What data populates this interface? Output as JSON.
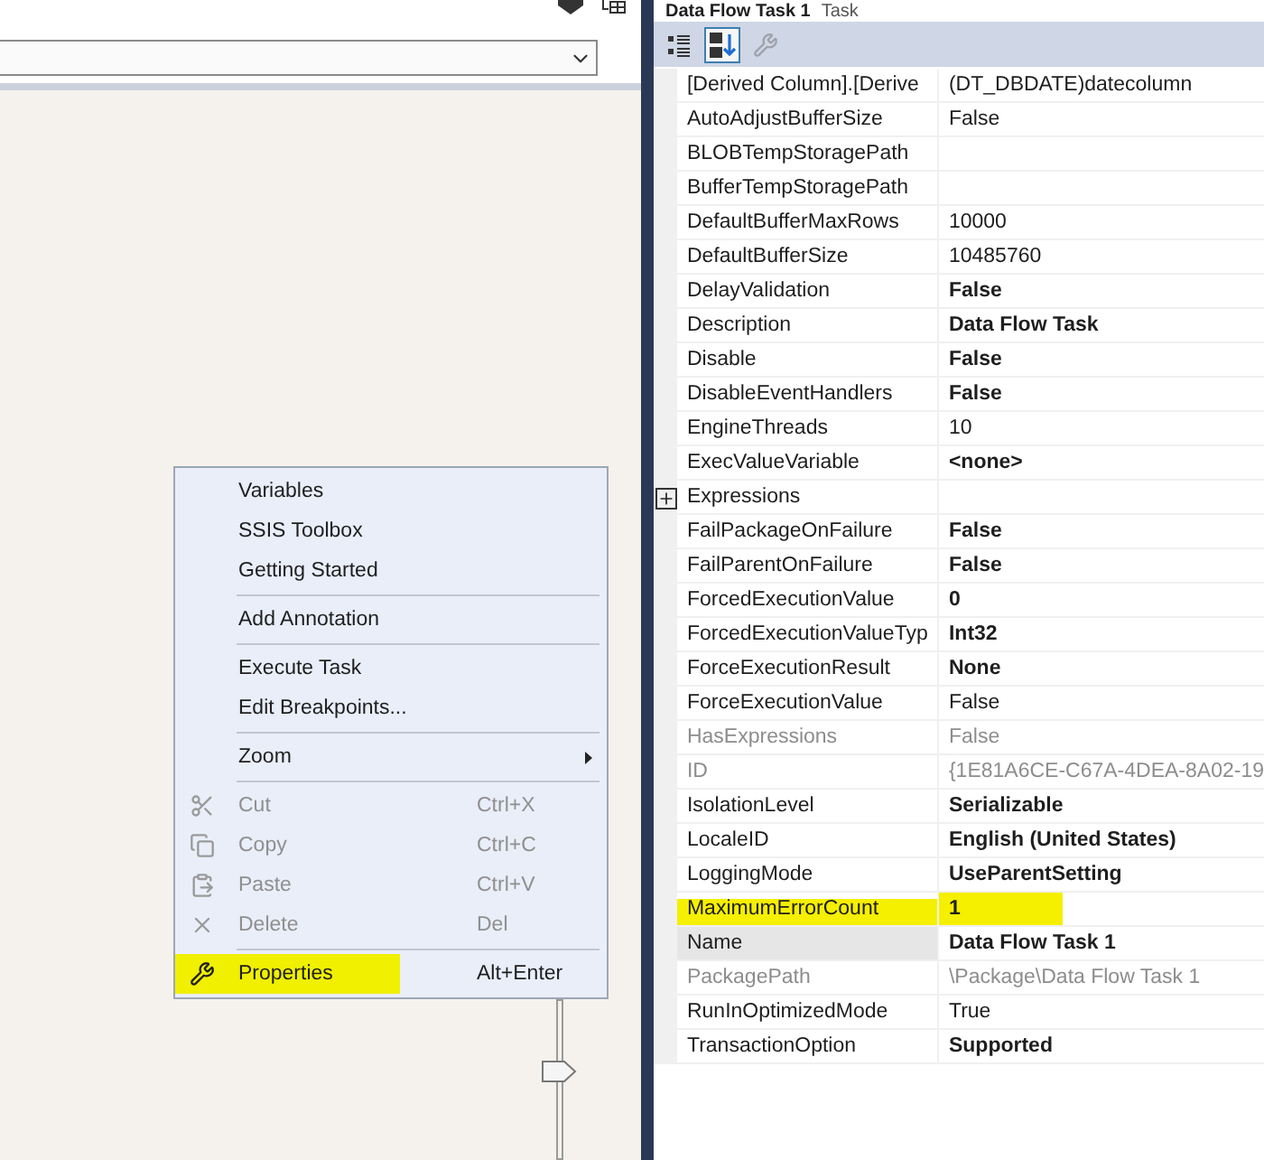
{
  "designer": {
    "zoom_slider": {
      "level": 0.5
    }
  },
  "context_menu": {
    "items": [
      {
        "kind": "plain",
        "label": "Variables",
        "disabled": false,
        "highlighted": false
      },
      {
        "kind": "plain",
        "label": "SSIS Toolbox",
        "disabled": false,
        "highlighted": false
      },
      {
        "kind": "plain",
        "label": "Getting Started",
        "disabled": false,
        "highlighted": false
      },
      {
        "kind": "separator"
      },
      {
        "kind": "plain",
        "label": "Add Annotation",
        "disabled": false,
        "highlighted": false
      },
      {
        "kind": "separator"
      },
      {
        "kind": "plain",
        "label": "Execute Task",
        "disabled": false,
        "highlighted": false
      },
      {
        "kind": "plain",
        "label": "Edit Breakpoints...",
        "disabled": false,
        "highlighted": false
      },
      {
        "kind": "separator"
      },
      {
        "kind": "submenu",
        "label": "Zoom",
        "disabled": false,
        "highlighted": false
      },
      {
        "kind": "separator"
      },
      {
        "kind": "scissors",
        "label": "Cut",
        "shortcut": "Ctrl+X",
        "disabled": true,
        "highlighted": false
      },
      {
        "kind": "copy",
        "label": "Copy",
        "shortcut": "Ctrl+C",
        "disabled": true,
        "highlighted": false
      },
      {
        "kind": "paste",
        "label": "Paste",
        "shortcut": "Ctrl+V",
        "disabled": true,
        "highlighted": false
      },
      {
        "kind": "delete",
        "label": "Delete",
        "shortcut": "Del",
        "disabled": true,
        "highlighted": false
      },
      {
        "kind": "separator"
      },
      {
        "kind": "wrench",
        "label": "Properties",
        "shortcut": "Alt+Enter",
        "disabled": false,
        "highlighted": true
      }
    ]
  },
  "properties": {
    "title": "Data Flow Task 1",
    "subtitle": "Task",
    "toolbar": [
      {
        "kind": "categorized",
        "selected": false,
        "disabled": false
      },
      {
        "kind": "alphabetical",
        "selected": true,
        "disabled": false
      },
      {
        "kind": "property-pages",
        "selected": false,
        "disabled": true
      }
    ],
    "rows": [
      {
        "name": "[Derived Column].[Derive",
        "value": "(DT_DBDATE)datecolumn",
        "bold": false,
        "readonly": false,
        "expandable": false,
        "selected": false,
        "highlighted": false
      },
      {
        "name": "AutoAdjustBufferSize",
        "value": "False",
        "bold": false,
        "readonly": false,
        "expandable": false,
        "selected": false,
        "highlighted": false
      },
      {
        "name": "BLOBTempStoragePath",
        "value": "",
        "bold": false,
        "readonly": false,
        "expandable": false,
        "selected": false,
        "highlighted": false
      },
      {
        "name": "BufferTempStoragePath",
        "value": "",
        "bold": false,
        "readonly": false,
        "expandable": false,
        "selected": false,
        "highlighted": false
      },
      {
        "name": "DefaultBufferMaxRows",
        "value": "10000",
        "bold": false,
        "readonly": false,
        "expandable": false,
        "selected": false,
        "highlighted": false
      },
      {
        "name": "DefaultBufferSize",
        "value": "10485760",
        "bold": false,
        "readonly": false,
        "expandable": false,
        "selected": false,
        "highlighted": false
      },
      {
        "name": "DelayValidation",
        "value": "False",
        "bold": true,
        "readonly": false,
        "expandable": false,
        "selected": false,
        "highlighted": false
      },
      {
        "name": "Description",
        "value": "Data Flow Task",
        "bold": true,
        "readonly": false,
        "expandable": false,
        "selected": false,
        "highlighted": false
      },
      {
        "name": "Disable",
        "value": "False",
        "bold": true,
        "readonly": false,
        "expandable": false,
        "selected": false,
        "highlighted": false
      },
      {
        "name": "DisableEventHandlers",
        "value": "False",
        "bold": true,
        "readonly": false,
        "expandable": false,
        "selected": false,
        "highlighted": false
      },
      {
        "name": "EngineThreads",
        "value": "10",
        "bold": false,
        "readonly": false,
        "expandable": false,
        "selected": false,
        "highlighted": false
      },
      {
        "name": "ExecValueVariable",
        "value": "<none>",
        "bold": true,
        "readonly": false,
        "expandable": false,
        "selected": false,
        "highlighted": false
      },
      {
        "name": "Expressions",
        "value": "",
        "bold": false,
        "readonly": false,
        "expandable": true,
        "selected": false,
        "highlighted": false
      },
      {
        "name": "FailPackageOnFailure",
        "value": "False",
        "bold": true,
        "readonly": false,
        "expandable": false,
        "selected": false,
        "highlighted": false
      },
      {
        "name": "FailParentOnFailure",
        "value": "False",
        "bold": true,
        "readonly": false,
        "expandable": false,
        "selected": false,
        "highlighted": false
      },
      {
        "name": "ForcedExecutionValue",
        "value": "0",
        "bold": true,
        "readonly": false,
        "expandable": false,
        "selected": false,
        "highlighted": false
      },
      {
        "name": "ForcedExecutionValueTyp",
        "value": "Int32",
        "bold": true,
        "readonly": false,
        "expandable": false,
        "selected": false,
        "highlighted": false
      },
      {
        "name": "ForceExecutionResult",
        "value": "None",
        "bold": true,
        "readonly": false,
        "expandable": false,
        "selected": false,
        "highlighted": false
      },
      {
        "name": "ForceExecutionValue",
        "value": "False",
        "bold": false,
        "readonly": false,
        "expandable": false,
        "selected": false,
        "highlighted": false
      },
      {
        "name": "HasExpressions",
        "value": "False",
        "bold": false,
        "readonly": true,
        "expandable": false,
        "selected": false,
        "highlighted": false
      },
      {
        "name": "ID",
        "value": "{1E81A6CE-C67A-4DEA-8A02-19",
        "bold": false,
        "readonly": true,
        "expandable": false,
        "selected": false,
        "highlighted": false
      },
      {
        "name": "IsolationLevel",
        "value": "Serializable",
        "bold": true,
        "readonly": false,
        "expandable": false,
        "selected": false,
        "highlighted": false
      },
      {
        "name": "LocaleID",
        "value": "English (United States)",
        "bold": true,
        "readonly": false,
        "expandable": false,
        "selected": false,
        "highlighted": false
      },
      {
        "name": "LoggingMode",
        "value": "UseParentSetting",
        "bold": true,
        "readonly": false,
        "expandable": false,
        "selected": false,
        "highlighted": false
      },
      {
        "name": "MaximumErrorCount",
        "value": "1",
        "bold": true,
        "readonly": false,
        "expandable": false,
        "selected": false,
        "highlighted": true
      },
      {
        "name": "Name",
        "value": "Data Flow Task 1",
        "bold": true,
        "readonly": false,
        "expandable": false,
        "selected": true,
        "highlighted": false
      },
      {
        "name": "PackagePath",
        "value": "\\Package\\Data Flow Task 1",
        "bold": false,
        "readonly": true,
        "expandable": false,
        "selected": false,
        "highlighted": false
      },
      {
        "name": "RunInOptimizedMode",
        "value": "True",
        "bold": false,
        "readonly": false,
        "expandable": false,
        "selected": false,
        "highlighted": false
      },
      {
        "name": "TransactionOption",
        "value": "Supported",
        "bold": true,
        "readonly": false,
        "expandable": false,
        "selected": false,
        "highlighted": false
      }
    ]
  }
}
